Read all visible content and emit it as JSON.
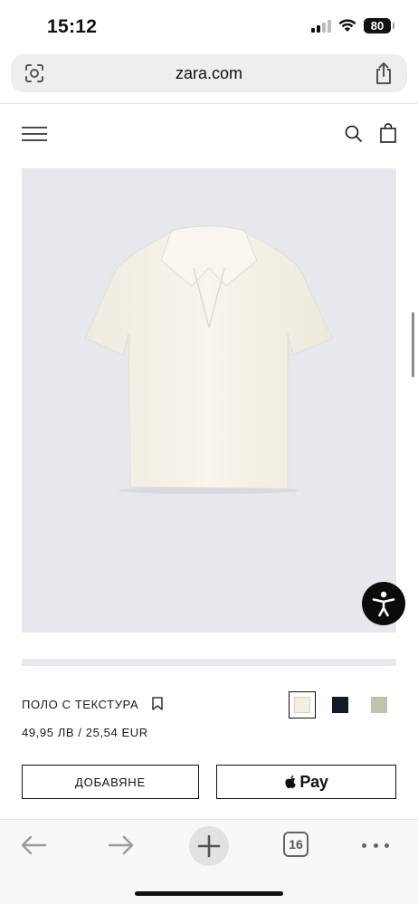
{
  "status_bar": {
    "time": "15:12",
    "battery": "80",
    "signal_level_of_4": 2
  },
  "browser": {
    "url": "zara.com",
    "tab_count": "16"
  },
  "header": {
    "icons": [
      "menu-icon",
      "search-icon",
      "shopping-bag-icon"
    ]
  },
  "product": {
    "name": "ПОЛО С ТЕКСТУРА",
    "price": "49,95 ЛВ / 25,54 EUR",
    "colors": [
      {
        "color": "#f3efe2",
        "selected": true
      },
      {
        "color": "#111b2b",
        "selected": false
      },
      {
        "color": "#c2c3ad",
        "selected": false
      }
    ]
  },
  "actions": {
    "add_label": "ДОБАВЯНЕ",
    "applepay_label": "Pay"
  },
  "colors": {
    "image_background": "#e6e8ed",
    "shirt": "#f4f1e6",
    "accent": "#111111"
  }
}
